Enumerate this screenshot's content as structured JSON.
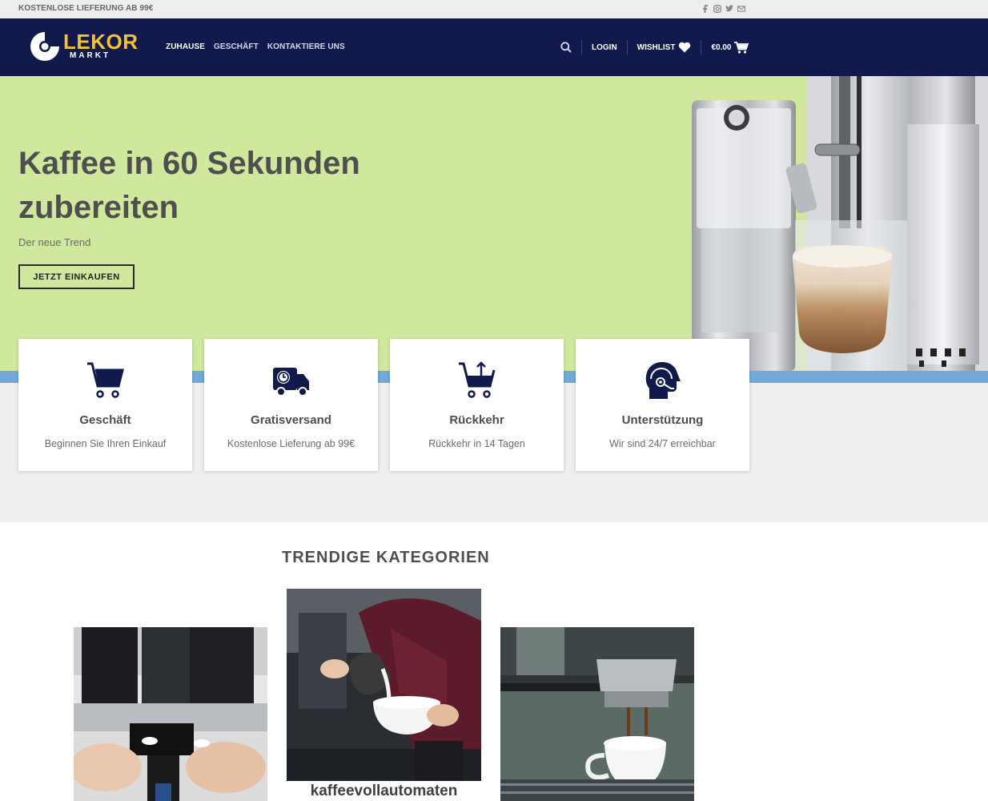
{
  "topbar": {
    "promo": "KOSTENLOSE LIEFERUNG AB 99€",
    "social_icons": [
      "facebook-icon",
      "instagram-icon",
      "twitter-icon",
      "mail-icon"
    ]
  },
  "header": {
    "logo_title": "LEKOR",
    "logo_sub": "MARKT",
    "nav": [
      {
        "label": "ZUHAUSE"
      },
      {
        "label": "GESCHÄFT"
      },
      {
        "label": "KONTAKTIERE UNS"
      }
    ],
    "login": "LOGIN",
    "wishlist": "WISHLIST",
    "cart_total": "€0.00",
    "colors": {
      "bar": "#121a4d",
      "accent": "#f2c230"
    }
  },
  "hero": {
    "title": "Kaffee in 60 Sekunden zubereiten",
    "subtitle": "Der neue Trend",
    "cta": "JETZT EINKAUFEN",
    "background": "#cfe89e"
  },
  "features": [
    {
      "icon": "cart-icon",
      "title": "Geschäft",
      "desc": "Beginnen Sie Ihren Einkauf"
    },
    {
      "icon": "delivery-truck-icon",
      "title": "Gratisversand",
      "desc": "Kostenlose Lieferung ab 99€"
    },
    {
      "icon": "cart-return-icon",
      "title": "Rückkehr",
      "desc": "Rückkehr in 14 Tagen"
    },
    {
      "icon": "headset-support-icon",
      "title": "Unterstützung",
      "desc": "Wir sind 24/7 erreichbar"
    }
  ],
  "trending": {
    "title": "TRENDIGE KATEGORIEN",
    "categories": [
      {
        "label": ""
      },
      {
        "label": "kaffeevollautomaten"
      },
      {
        "label": ""
      }
    ]
  }
}
